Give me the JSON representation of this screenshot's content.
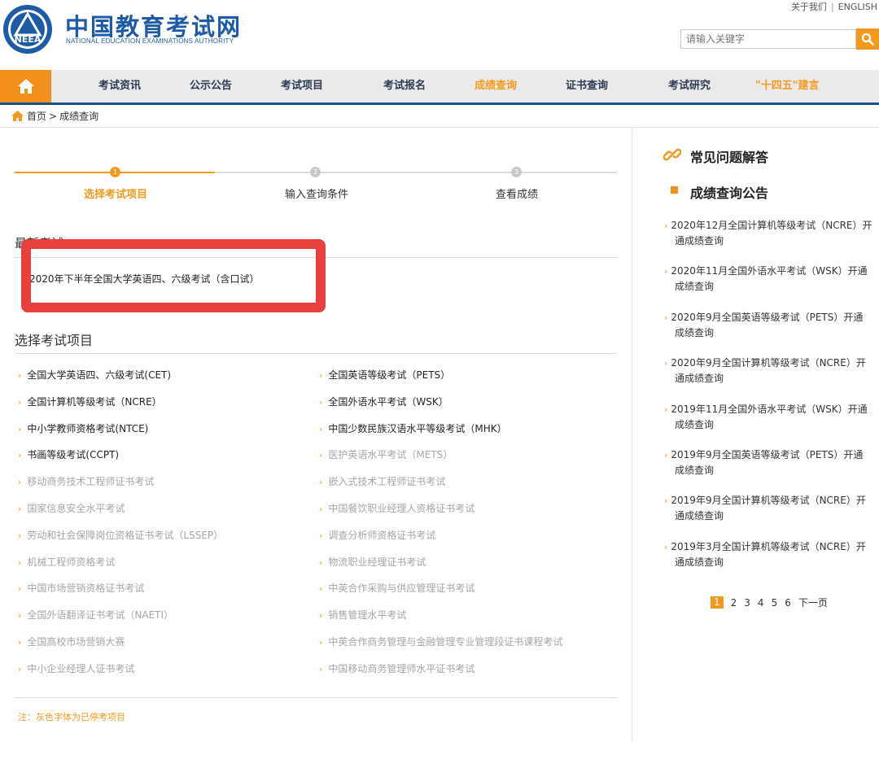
{
  "header": {
    "logo_cn": "中国教育考试网",
    "logo_en": "NATIONAL EDUCATION EXAMINATIONS AUTHORITY",
    "seal_text": "NEEA",
    "about": "关于我们",
    "separator": "|",
    "english": "ENGLISH",
    "search_placeholder": "请输入关键字"
  },
  "nav": {
    "items": [
      {
        "label": "考试资讯"
      },
      {
        "label": "公示公告"
      },
      {
        "label": "考试项目"
      },
      {
        "label": "考试报名"
      },
      {
        "label": "成绩查询"
      },
      {
        "label": "证书查询"
      },
      {
        "label": "考试研究"
      },
      {
        "label": "\"十四五\"建言"
      }
    ]
  },
  "breadcrumb": {
    "home": "首页",
    "sep": ">",
    "current": "成绩查询"
  },
  "steps": [
    {
      "num": "1",
      "label": "选择考试项目"
    },
    {
      "num": "2",
      "label": "输入查询条件"
    },
    {
      "num": "3",
      "label": "查看成绩"
    }
  ],
  "latest": {
    "title": "最新考试",
    "item": "2020年下半年全国大学英语四、六级考试（含口试）"
  },
  "select": {
    "title": "选择考试项目",
    "left": [
      "全国大学英语四、六级考试(CET)",
      "全国计算机等级考试（NCRE）",
      "中小学教师资格考试(NTCE)",
      "书画等级考试(CCPT)",
      "移动商务技术工程师证书考试",
      "国家信息安全水平考试",
      "劳动和社会保障岗位资格证书考试（LSSEP）",
      "机械工程师资格考试",
      "中国市场营销资格证书考试",
      "全国外语翻译证书考试（NAETI）",
      "全国高校市场营销大赛",
      "中小企业经理人证书考试"
    ],
    "right": [
      "全国英语等级考试（PETS）",
      "全国外语水平考试（WSK）",
      "中国少数民族汉语水平等级考试（MHK）",
      "医护英语水平考试（METS）",
      "嵌入式技术工程师证书考试",
      "中国餐饮职业经理人资格证书考试",
      "调查分析师资格证书考试",
      "物流职业经理证书考试",
      "中英合作采购与供应管理证书考试",
      "销售管理水平考试",
      "中英合作商务管理与金融管理专业管理段证书课程考试",
      "中国移动商务管理师水平证书考试"
    ],
    "note": "注：灰色字体为已停考项目"
  },
  "sidebar": {
    "faq_title": "常见问题解答",
    "notice_title": "成绩查询公告",
    "notices": [
      {
        "line1": "2020年12月全国计算机等级考试（NCRE）开",
        "line2": "通成绩查询"
      },
      {
        "line1": "2020年11月全国外语水平考试（WSK）开通",
        "line2": "成绩查询"
      },
      {
        "line1": "2020年9月全国英语等级考试（PETS）开通",
        "line2": "成绩查询"
      },
      {
        "line1": "2020年9月全国计算机等级考试（NCRE）开",
        "line2": "通成绩查询"
      },
      {
        "line1": "2019年11月全国外语水平考试（WSK）开通",
        "line2": "成绩查询"
      },
      {
        "line1": "2019年9月全国英语等级考试（PETS）开通",
        "line2": "成绩查询"
      },
      {
        "line1": "2019年9月全国计算机等级考试（NCRE）开",
        "line2": "通成绩查询"
      },
      {
        "line1": "2019年3月全国计算机等级考试（NCRE）开",
        "line2": "通成绩查询"
      }
    ],
    "pager": [
      "1",
      "2",
      "3",
      "4",
      "5",
      "6",
      "下一页"
    ]
  },
  "colors": {
    "accent": "#f39a1c",
    "brand_blue": "#1d5aa8",
    "nav_border": "#1b4f93",
    "annotation_red": "#e8403c",
    "disabled_text": "#a5a5a5"
  }
}
